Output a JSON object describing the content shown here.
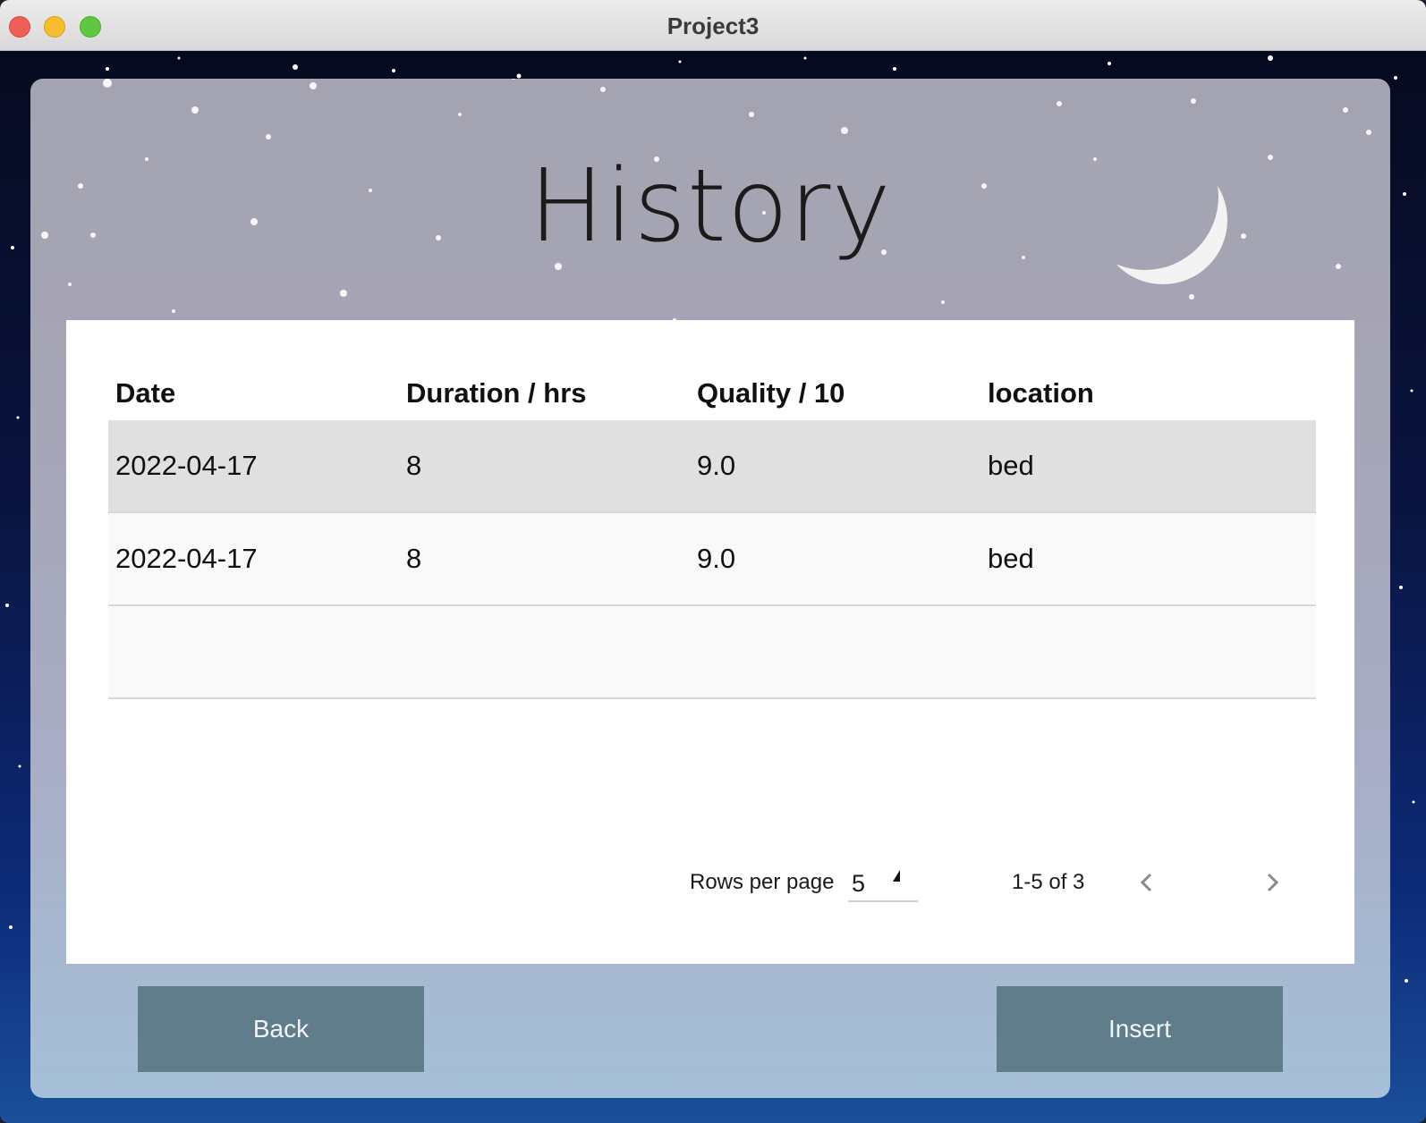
{
  "window": {
    "title": "Project3"
  },
  "page": {
    "title": "History"
  },
  "table": {
    "columns": [
      "Date",
      "Duration / hrs",
      "Quality / 10",
      "location"
    ],
    "rows": [
      {
        "date": "2022-04-17",
        "duration": "8",
        "quality": "9.0",
        "location": "bed"
      },
      {
        "date": "2022-04-17",
        "duration": "8",
        "quality": "9.0",
        "location": "bed"
      }
    ]
  },
  "pagination": {
    "rows_per_page_label": "Rows per page",
    "rows_per_page_value": "5",
    "range_text": "1-5 of 3"
  },
  "buttons": {
    "back": "Back",
    "insert": "Insert"
  },
  "colors": {
    "button_bg": "#607d8b",
    "selected_row": "#e0e0e0"
  },
  "icons": {
    "prev": "chevron-left-icon",
    "next": "chevron-right-icon",
    "dropdown": "dropdown-arrow-icon"
  }
}
